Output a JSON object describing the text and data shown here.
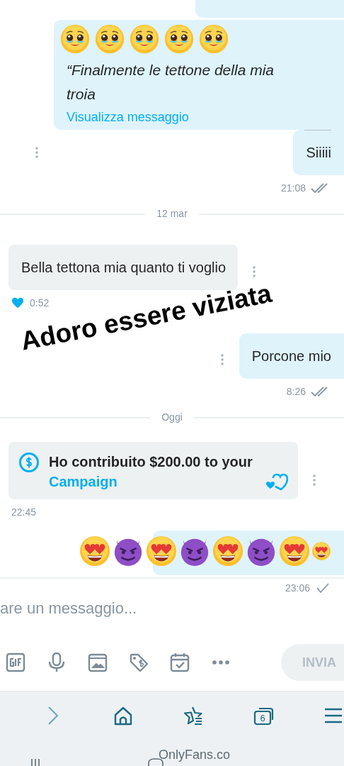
{
  "caption": "Adoro essere viziata",
  "messages": [
    {
      "kind": "fragment",
      "outgoing": true
    },
    {
      "kind": "quote",
      "outgoing": true,
      "stickers": [
        {
          "kind": "tearful"
        },
        {
          "kind": "tearful"
        },
        {
          "kind": "tearful"
        },
        {
          "kind": "tearful"
        },
        {
          "kind": "tearful"
        }
      ],
      "text": "“Finalmente le tettone della mia troia",
      "link": "Visualizza messaggio"
    },
    {
      "kind": "text",
      "outgoing": true,
      "text": "Siiiii",
      "time": "21:08",
      "read": true,
      "rule": true
    },
    {
      "kind": "divider",
      "text": "12 mar"
    },
    {
      "kind": "text",
      "outgoing": false,
      "text": "Bella tettona mia quanto ti voglio",
      "time": "0:52",
      "liked": true
    },
    {
      "kind": "text",
      "outgoing": true,
      "text": "Porcone mio",
      "time": "8:26",
      "read": true
    },
    {
      "kind": "divider",
      "text": "Oggi"
    },
    {
      "kind": "tip",
      "outgoing": false,
      "text": "Ho contribuito $200.00 to your ",
      "link": "Campaign",
      "time": "22:45"
    },
    {
      "kind": "stickers",
      "outgoing": true,
      "stickers": [
        {
          "kind": "heart_eyes"
        },
        {
          "kind": "devil"
        },
        {
          "kind": "heart_eyes"
        },
        {
          "kind": "devil"
        },
        {
          "kind": "heart_eyes"
        },
        {
          "kind": "devil"
        },
        {
          "kind": "heart_eyes"
        },
        {
          "kind": "heart_eyes_small"
        }
      ],
      "time": "23:06",
      "read": false
    }
  ],
  "composer": {
    "placeholder": "are un messaggio...",
    "send": "INVIA",
    "send_disabled": true
  },
  "browser": {
    "tab_count": "6",
    "address": "OnlyFans.co"
  }
}
